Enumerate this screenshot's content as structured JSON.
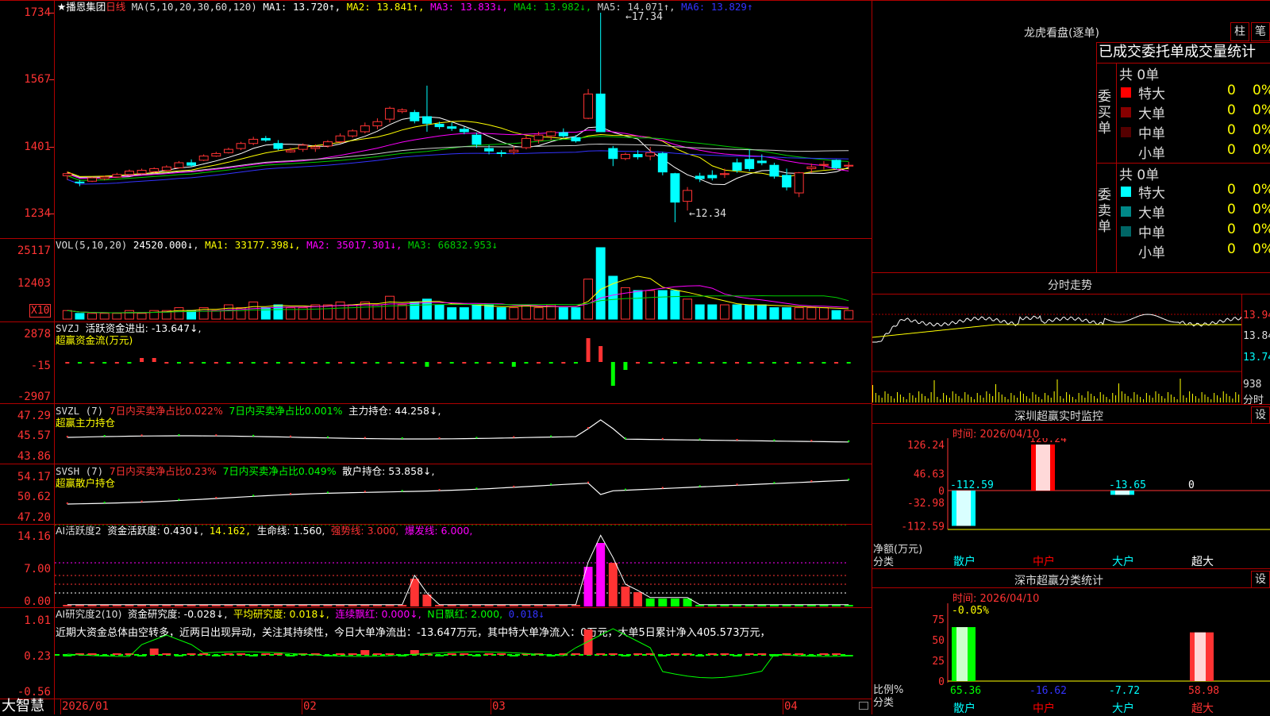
{
  "stock": {
    "name": "播恩集团",
    "period": "日线",
    "star": "★",
    "ma_label": "MA(5,10,20,30,60,120)"
  },
  "ma_legend": [
    {
      "label": "MA1: 13.720↑",
      "color": "#ffffff"
    },
    {
      "label": "MA2: 13.841↑",
      "color": "#ffff00"
    },
    {
      "label": "MA3: 13.833↓",
      "color": "#ff00ff"
    },
    {
      "label": "MA4: 13.982↓",
      "color": "#00cc00"
    },
    {
      "label": "MA5: 14.071↑",
      "color": "#cccccc"
    },
    {
      "label": "MA6: 13.829↑",
      "color": "#3333ff"
    }
  ],
  "price_axis": [
    "1734",
    "1567",
    "1401",
    "1234"
  ],
  "price_annotations": {
    "high": "←17.34",
    "low": "←12.34"
  },
  "vol": {
    "label": "VOL(5,10,20)",
    "value": "24520.000↓",
    "legend": [
      {
        "label": "MA1: 33177.398↓",
        "color": "#ffff00"
      },
      {
        "label": "MA2: 35017.301↓",
        "color": "#ff00ff"
      },
      {
        "label": "MA3: 66832.953↓",
        "color": "#00cc00"
      }
    ],
    "axis": [
      "25117",
      "12403"
    ],
    "unit": "X10"
  },
  "svzj": {
    "label": "SVZJ",
    "desc": "活跃资金进出: -13.647↓,",
    "sub": "超赢资金流(万元)",
    "axis": [
      "2878",
      "-15",
      "-2907"
    ]
  },
  "svzl": {
    "label": "SVZL (7)",
    "p1": "7日内买卖净占比0.022%",
    "p2": "7日内买卖净占比0.001%",
    "p3": "主力持仓: 44.258↓,",
    "sub": "超赢主力持仓",
    "axis": [
      "47.29",
      "45.57",
      "43.86"
    ]
  },
  "svsh": {
    "label": "SVSH (7)",
    "p1": "7日内买卖净占比0.23%",
    "p2": "7日内买卖净占比0.049%",
    "p3": "散户持仓: 53.858↓,",
    "sub": "超赢散户持仓",
    "axis": [
      "54.17",
      "50.62",
      "47.20"
    ]
  },
  "ai_active": {
    "label": "AI活跃度2",
    "p1": "资金活跃度: 0.430↓,",
    "p2": "14.162,",
    "p3": "生命线: 1.560,",
    "p4": "强势线: 3.000,",
    "p5": "爆发线: 6.000,",
    "axis": [
      "14.16",
      "7.00",
      "0.00"
    ]
  },
  "ai_research": {
    "label": "AI研究度2(10)",
    "p1": "资金研究度: -0.028↓,",
    "p2": "平均研究度: 0.018↓,",
    "p3": "连续飘红: 0.000↓,",
    "p4": "N日飘红: 2.000,",
    "p5": "0.018↓",
    "comment": "近期大资金总体由空转多，近两日出现异动，关注其持续性，今日大单净流出：-13.647万元，其中特大单净流入：0万元，大单5日累计净入405.573万元，",
    "axis": [
      "1.01",
      "0.23",
      "-0.56"
    ]
  },
  "dates": [
    "2026/01",
    "02",
    "03",
    "04"
  ],
  "logo": "大智慧",
  "dragon": {
    "title": "龙虎看盘(逐单)",
    "btn1": "柱",
    "btn2": "笔",
    "stats_title": "已成交委托单成交量统计",
    "buy_label": "委买单",
    "sell_label": "委卖单",
    "buy_total": "共 0单",
    "sell_total": "共 0单",
    "buy_rows": [
      {
        "name": "特大",
        "count": "0",
        "pct": "0%",
        "color": "#ff0000"
      },
      {
        "name": "大单",
        "count": "0",
        "pct": "0%",
        "color": "#880000"
      },
      {
        "name": "中单",
        "count": "0",
        "pct": "0%",
        "color": "#550000"
      },
      {
        "name": "小单",
        "count": "0",
        "pct": "0%",
        "color": "#000000"
      }
    ],
    "sell_rows": [
      {
        "name": "特大",
        "count": "0",
        "pct": "0%",
        "color": "#00ffff"
      },
      {
        "name": "大单",
        "count": "0",
        "pct": "0%",
        "color": "#008888"
      },
      {
        "name": "中单",
        "count": "0",
        "pct": "0%",
        "color": "#006666"
      },
      {
        "name": "小单",
        "count": "0",
        "pct": "0%",
        "color": "#000000"
      }
    ]
  },
  "intraday": {
    "title": "分时走势",
    "axis": [
      "13.94",
      "13.84",
      "13.74"
    ],
    "vol_label": "938",
    "vol_unit": "分时"
  },
  "monitor": {
    "title": "深圳超赢实时监控",
    "btn": "设",
    "time": "时间: 2026/04/10",
    "axis": [
      "126.24",
      "46.63",
      "0",
      "-32.98",
      "-112.59"
    ],
    "top_value": "126.24",
    "values": [
      {
        "label": "-112.59",
        "value": -112.59,
        "color": "#00ffff"
      },
      {
        "label": "126.24",
        "value": 126.24,
        "color": "#ff0000"
      },
      {
        "label": "-13.65",
        "value": -13.65,
        "color": "#00ffff"
      },
      {
        "label": "0",
        "value": 0,
        "color": "#ff0000"
      }
    ],
    "ylabel1": "净额(万元)",
    "ylabel2": "分类",
    "categories": [
      {
        "name": "散户",
        "color": "#00ffff"
      },
      {
        "name": "中户",
        "color": "#ff0000"
      },
      {
        "name": "大户",
        "color": "#00ffff"
      },
      {
        "name": "超大",
        "color": "#ffffff"
      }
    ]
  },
  "classify": {
    "title": "深市超赢分类统计",
    "btn": "设",
    "time": "时间: 2026/04/10",
    "axis": [
      "75",
      "50",
      "25",
      "0"
    ],
    "top_note": "-0.05%",
    "ylabel1": "比例%",
    "ylabel2": "分类",
    "values": [
      {
        "label": "65.36",
        "value": 65.36,
        "color": "#00ff00"
      },
      {
        "label": "-16.62",
        "value": -16.62,
        "color": "#3333ff"
      },
      {
        "label": "-7.72",
        "value": -7.72,
        "color": "#00ffff"
      },
      {
        "label": "58.98",
        "value": 58.98,
        "color": "#ff3333"
      }
    ],
    "categories": [
      {
        "name": "散户",
        "color": "#00ffff"
      },
      {
        "name": "中户",
        "color": "#ff0000"
      },
      {
        "name": "大户",
        "color": "#00ffff"
      },
      {
        "name": "超大",
        "color": "#ff3333"
      }
    ]
  },
  "chart_data": [
    {
      "type": "candlestick",
      "title": "播恩集团 日线",
      "x": [
        "2026/01",
        "02",
        "03",
        "04"
      ],
      "ylim": [
        12.34,
        17.34
      ],
      "ohlc": [
        [
          13.45,
          13.55,
          13.35,
          13.5
        ],
        [
          13.3,
          13.35,
          13.2,
          13.28
        ],
        [
          13.32,
          13.42,
          13.3,
          13.4
        ],
        [
          13.38,
          13.45,
          13.34,
          13.42
        ],
        [
          13.42,
          13.52,
          13.4,
          13.48
        ],
        [
          13.48,
          13.6,
          13.45,
          13.56
        ],
        [
          13.5,
          13.62,
          13.48,
          13.58
        ],
        [
          13.55,
          13.65,
          13.52,
          13.62
        ],
        [
          13.58,
          13.7,
          13.56,
          13.66
        ],
        [
          13.64,
          13.8,
          13.62,
          13.76
        ],
        [
          13.76,
          13.84,
          13.66,
          13.7
        ],
        [
          13.82,
          13.96,
          13.8,
          13.92
        ],
        [
          13.92,
          14.02,
          13.9,
          13.98
        ],
        [
          14.0,
          14.12,
          13.98,
          14.08
        ],
        [
          14.1,
          14.26,
          14.06,
          14.22
        ],
        [
          14.22,
          14.38,
          14.18,
          14.32
        ],
        [
          14.34,
          14.4,
          14.26,
          14.3
        ],
        [
          14.22,
          14.3,
          14.06,
          14.1
        ],
        [
          14.02,
          14.12,
          14.0,
          14.06
        ],
        [
          14.08,
          14.22,
          14.02,
          14.18
        ],
        [
          14.1,
          14.2,
          14.02,
          14.14
        ],
        [
          14.16,
          14.3,
          14.12,
          14.26
        ],
        [
          14.26,
          14.46,
          14.22,
          14.4
        ],
        [
          14.4,
          14.56,
          14.36,
          14.52
        ],
        [
          14.5,
          14.72,
          14.46,
          14.64
        ],
        [
          14.64,
          14.82,
          14.56,
          14.74
        ],
        [
          14.8,
          15.1,
          14.72,
          15.06
        ],
        [
          14.98,
          15.06,
          14.94,
          15.02
        ],
        [
          14.96,
          15.02,
          14.7,
          14.76
        ],
        [
          14.86,
          15.6,
          14.5,
          14.7
        ],
        [
          14.68,
          14.74,
          14.56,
          14.62
        ],
        [
          14.62,
          14.72,
          14.52,
          14.58
        ],
        [
          14.56,
          14.62,
          14.44,
          14.5
        ],
        [
          14.42,
          14.48,
          14.12,
          14.2
        ],
        [
          14.1,
          14.18,
          13.96,
          14.04
        ],
        [
          14.0,
          14.06,
          13.9,
          13.98
        ],
        [
          14.02,
          14.16,
          13.96,
          14.06
        ],
        [
          14.12,
          14.4,
          14.08,
          14.34
        ],
        [
          14.3,
          14.5,
          14.22,
          14.42
        ],
        [
          14.4,
          14.52,
          14.3,
          14.5
        ],
        [
          14.48,
          14.58,
          14.36,
          14.4
        ],
        [
          14.36,
          14.42,
          14.24,
          14.28
        ],
        [
          14.82,
          15.52,
          14.8,
          15.4
        ],
        [
          15.4,
          17.34,
          14.8,
          14.5
        ],
        [
          14.1,
          14.16,
          13.68,
          13.86
        ],
        [
          13.86,
          14.0,
          13.82,
          13.96
        ],
        [
          13.96,
          14.06,
          13.84,
          13.9
        ],
        [
          13.92,
          14.14,
          13.82,
          14.0
        ],
        [
          13.98,
          14.02,
          13.46,
          13.54
        ],
        [
          13.5,
          13.52,
          12.34,
          12.82
        ],
        [
          12.84,
          13.18,
          12.62,
          13.1
        ],
        [
          13.44,
          13.52,
          13.3,
          13.38
        ],
        [
          13.46,
          13.58,
          13.34,
          13.4
        ],
        [
          13.48,
          13.62,
          13.4,
          13.5
        ],
        [
          13.76,
          13.86,
          13.52,
          13.58
        ],
        [
          13.84,
          14.08,
          13.56,
          13.62
        ],
        [
          13.8,
          13.96,
          13.7,
          13.76
        ],
        [
          13.7,
          13.76,
          13.38,
          13.44
        ],
        [
          13.46,
          13.62,
          13.1,
          13.18
        ],
        [
          13.04,
          13.54,
          12.94,
          13.52
        ],
        [
          13.62,
          13.74,
          13.52,
          13.66
        ],
        [
          13.7,
          13.8,
          13.6,
          13.72
        ],
        [
          13.82,
          13.84,
          13.6,
          13.64
        ],
        [
          13.68,
          13.78,
          13.6,
          13.7
        ]
      ]
    },
    {
      "type": "bar",
      "title": "VOL(5,10,20)",
      "values": [
        3,
        2,
        2,
        2,
        2,
        3,
        2,
        3,
        3,
        4,
        3,
        4,
        3,
        5,
        4,
        6,
        4,
        5,
        4,
        4,
        5,
        5,
        6,
        5,
        6,
        5,
        8,
        5,
        6,
        7,
        5,
        4,
        4,
        5,
        5,
        4,
        4,
        5,
        4,
        5,
        4,
        4,
        14,
        25,
        15,
        11,
        10,
        10,
        10,
        10,
        7,
        5,
        5,
        5,
        5,
        5,
        5,
        4,
        4,
        4,
        4,
        4,
        3,
        3
      ],
      "ylim": [
        0,
        25117
      ]
    }
  ]
}
